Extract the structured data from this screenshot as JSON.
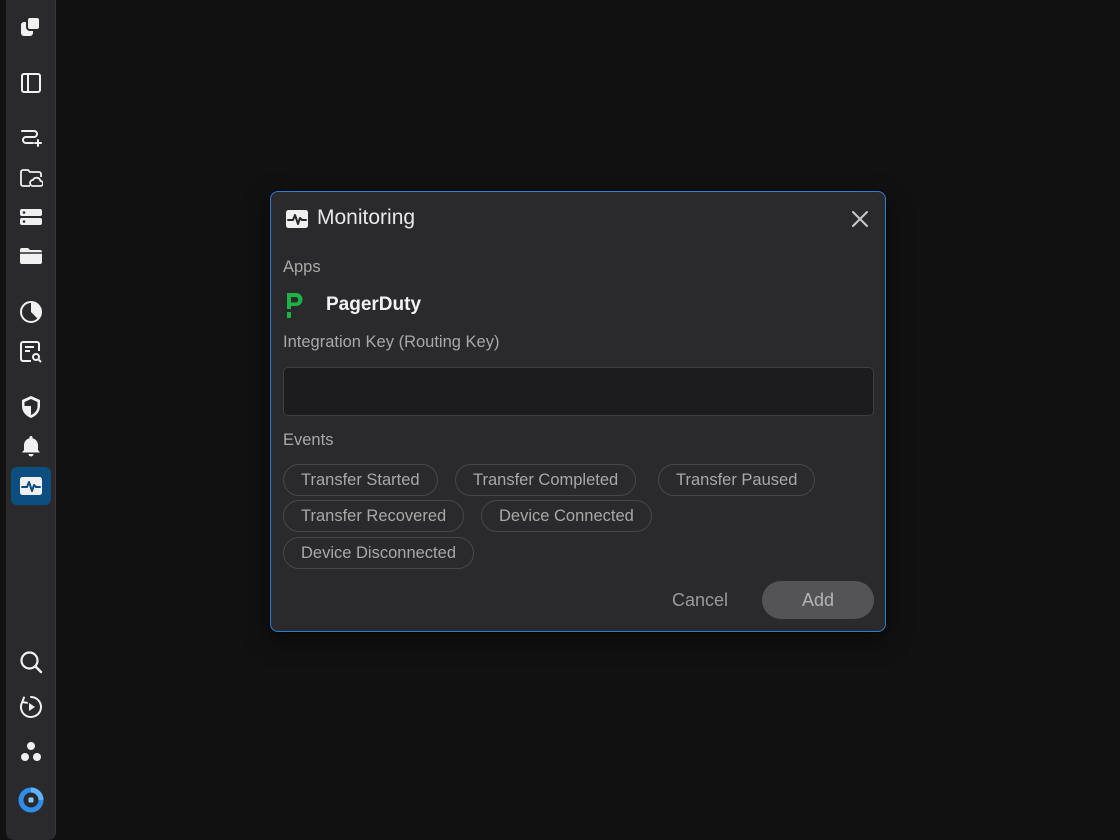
{
  "sidebar": {
    "items": [
      {
        "name": "app-logo-icon"
      },
      {
        "name": "panel-layout-icon"
      },
      {
        "name": "transfer-route-icon"
      },
      {
        "name": "cloud-folder-icon"
      },
      {
        "name": "server-storage-icon"
      },
      {
        "name": "folder-icon"
      },
      {
        "name": "pie-chart-icon"
      },
      {
        "name": "document-search-icon"
      },
      {
        "name": "shield-icon"
      },
      {
        "name": "bell-icon"
      },
      {
        "name": "monitoring-pulse-icon",
        "active": true
      },
      {
        "name": "search-icon"
      },
      {
        "name": "play-circle-icon"
      },
      {
        "name": "nodes-cluster-icon"
      },
      {
        "name": "blue-ring-logo-icon"
      }
    ],
    "active_color": "#0d4e80"
  },
  "dialog": {
    "title": "Monitoring",
    "apps_label": "Apps",
    "app": {
      "name": "PagerDuty",
      "logo_color": "#1db343"
    },
    "key_label": "Integration Key (Routing Key)",
    "key_value": "",
    "events_label": "Events",
    "events": [
      "Transfer Started",
      "Transfer Completed",
      "Transfer Paused",
      "Transfer Recovered",
      "Device Connected",
      "Device Disconnected"
    ],
    "cancel_label": "Cancel",
    "add_label": "Add",
    "border_color": "#2f7fd8"
  }
}
